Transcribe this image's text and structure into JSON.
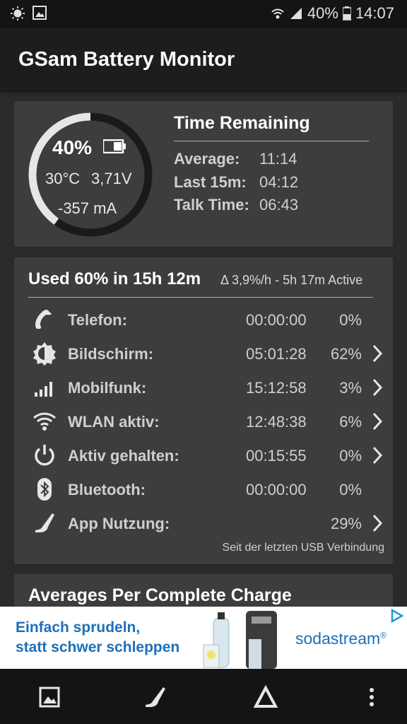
{
  "status_bar": {
    "battery": "40%",
    "time": "14:07"
  },
  "app_bar": {
    "title": "GSam Battery Monitor"
  },
  "battery_card": {
    "level_percent": "40%",
    "level_fraction": 0.4,
    "temperature": "30°C",
    "voltage": "3,71V",
    "current": "-357 mA",
    "time_remaining": {
      "title": "Time Remaining",
      "rows": [
        {
          "label": "Average:",
          "value": "11:14"
        },
        {
          "label": "Last 15m:",
          "value": "04:12"
        },
        {
          "label": "Talk Time:",
          "value": "06:43"
        }
      ]
    }
  },
  "usage_card": {
    "title": "Used 60% in 15h 12m",
    "subtitle": "Δ 3,9%/h - 5h 17m Active",
    "rows": [
      {
        "icon": "phone-icon",
        "label": "Telefon:",
        "time": "00:00:00",
        "percent": "0%",
        "has_chevron": false
      },
      {
        "icon": "brightness-icon",
        "label": "Bildschirm:",
        "time": "05:01:28",
        "percent": "62%",
        "has_chevron": true
      },
      {
        "icon": "signal-icon",
        "label": "Mobilfunk:",
        "time": "15:12:58",
        "percent": "3%",
        "has_chevron": true
      },
      {
        "icon": "wifi-icon",
        "label": "WLAN aktiv:",
        "time": "12:48:38",
        "percent": "6%",
        "has_chevron": true
      },
      {
        "icon": "power-icon",
        "label": "Aktiv gehalten:",
        "time": "00:15:55",
        "percent": "0%",
        "has_chevron": true
      },
      {
        "icon": "bluetooth-icon",
        "label": "Bluetooth:",
        "time": "00:00:00",
        "percent": "0%",
        "has_chevron": false
      },
      {
        "icon": "app-usage-icon",
        "label": "App Nutzung:",
        "time": "",
        "percent": "29%",
        "has_chevron": true
      }
    ],
    "footnote": "Seit der letzten USB Verbindung"
  },
  "averages_card": {
    "title": "Averages Per Complete Charge"
  },
  "ad": {
    "line1": "Einfach sprudeln,",
    "line2": "statt schwer schleppen",
    "brand": "sodastream",
    "brand_mark": "®"
  },
  "colors": {
    "accent": "#1d6fb8",
    "card": "#3d3d3d",
    "background": "#2a2a2a"
  }
}
